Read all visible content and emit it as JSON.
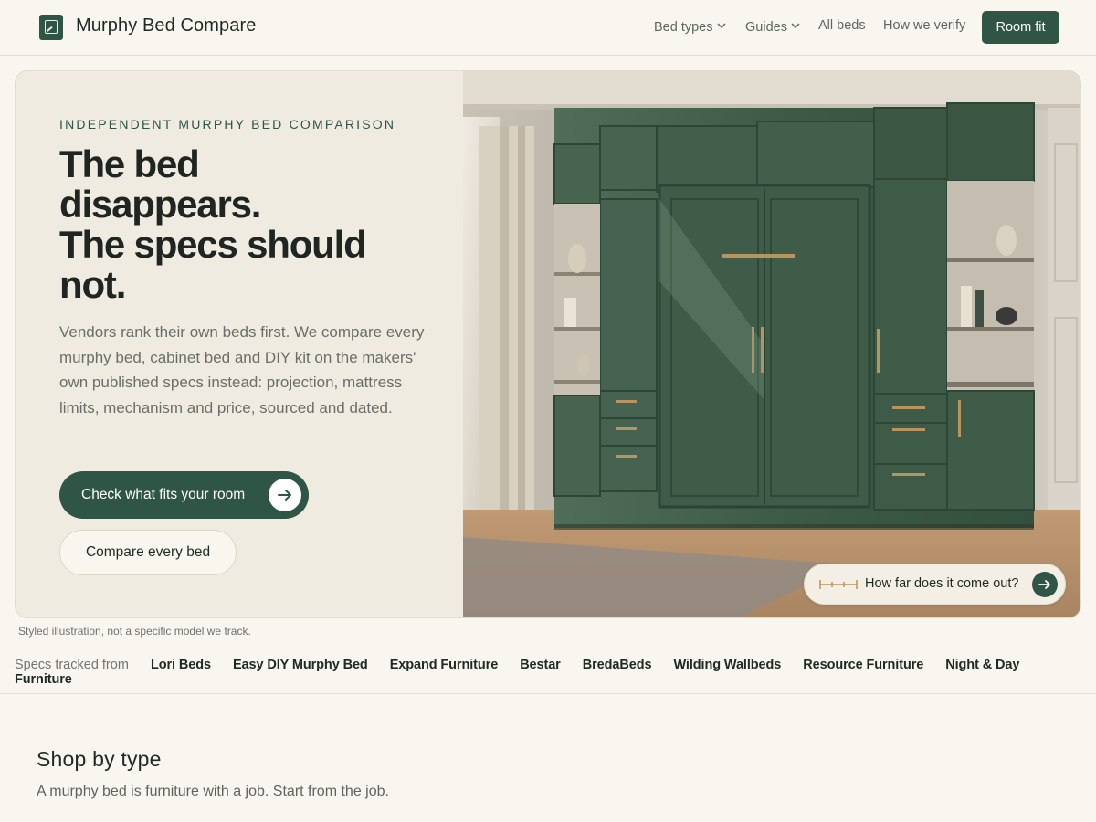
{
  "header": {
    "brand": "Murphy Bed Compare",
    "logo_icon": "bed-frame-icon",
    "nav": {
      "bed_types": "Bed types",
      "guides": "Guides",
      "all_beds": "All beds",
      "how_we_verify": "How we verify"
    },
    "cta": "Room fit"
  },
  "hero": {
    "eyebrow": "INDEPENDENT MURPHY BED COMPARISON",
    "headline_lines": [
      "The bed",
      "disappears.",
      "The specs should",
      "not."
    ],
    "lede": "Vendors rank their own beds first. We compare every murphy bed, cabinet bed and DIY kit on the makers' own published specs instead: projection, mattress limits, mechanism and price, sourced and dated.",
    "primary_cta": "Check what fits your room",
    "secondary_cta": "Compare every bed",
    "image_pill": "How far does it come out?",
    "caption": "Styled illustration, not a specific model we track."
  },
  "brands": {
    "lead": "Specs tracked from",
    "items": [
      "Lori Beds",
      "Easy DIY Murphy Bed",
      "Expand Furniture",
      "Bestar",
      "BredaBeds",
      "Wilding Wallbeds",
      "Resource Furniture",
      "Night & Day Furniture"
    ]
  },
  "section": {
    "title": "Shop by type",
    "subtitle": "A murphy bed is furniture with a job. Start from the job."
  },
  "colors": {
    "accent": "#2f5546",
    "background": "#f9f6f0",
    "hero_panel": "#efebe1"
  }
}
